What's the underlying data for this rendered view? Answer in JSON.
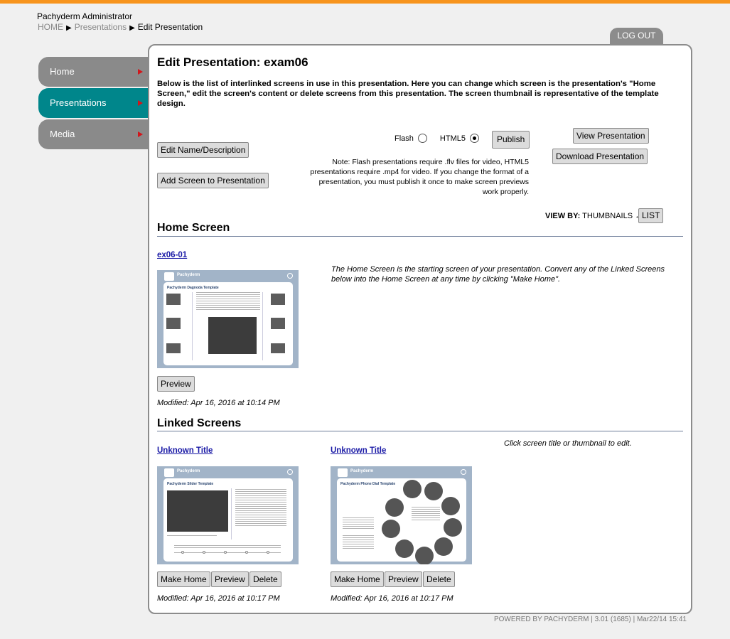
{
  "header": {
    "app_title": "Pachyderm Administrator",
    "breadcrumb": {
      "home": "HOME",
      "presentations": "Presentations",
      "current": "Edit Presentation"
    },
    "logout_label": "LOG OUT"
  },
  "sidebar": {
    "items": [
      {
        "label": "Home"
      },
      {
        "label": "Presentations"
      },
      {
        "label": "Media"
      }
    ]
  },
  "main": {
    "title": "Edit Presentation: exam06",
    "intro": "Below is the list of interlinked screens in use in this presentation. Here you can change which screen is the presentation's \"Home Screen,\" edit the screen's content or delete screens from this presentation. The screen thumbnail is representative of the template design.",
    "buttons": {
      "edit_name": "Edit Name/Description",
      "add_screen": "Add Screen to Presentation",
      "publish": "Publish",
      "view_presentation": "View Presentation",
      "download_presentation": "Download Presentation"
    },
    "format": {
      "flash_label": "Flash",
      "html5_label": "HTML5",
      "selected": "HTML5"
    },
    "note": "Note: Flash presentations require .flv files for video, HTML5 presentations require .mp4 for video. If you change the format of a presentation, you must publish it once to make screen previews work properly.",
    "view_by": {
      "label": "VIEW BY:",
      "current": "THUMBNAILS",
      "arrow": "↔",
      "alternative": "LIST"
    },
    "home_screen": {
      "section_title": "Home Screen",
      "screen_title": "ex06-01",
      "description": "The Home Screen is the starting screen of your presentation. Convert any of the Linked Screens below into the Home Screen at any time by clicking \"Make Home\".",
      "preview_label": "Preview",
      "modified": "Modified: Apr 16, 2016 at 10:14 PM",
      "thumbnail": {
        "brand": "Pachyderm",
        "template": "Pachyderm Dagnoda Template"
      }
    },
    "linked_screens": {
      "section_title": "Linked Screens",
      "hint": "Click screen title or thumbnail to edit.",
      "screens": [
        {
          "title": "Unknown Title",
          "make_home_label": "Make Home",
          "preview_label": "Preview",
          "delete_label": "Delete",
          "modified": "Modified: Apr 16, 2016 at 10:17 PM",
          "thumbnail": {
            "brand": "Pachyderm",
            "template": "Pachyderm Slider Template"
          }
        },
        {
          "title": "Unknown Title",
          "make_home_label": "Make Home",
          "preview_label": "Preview",
          "delete_label": "Delete",
          "modified": "Modified: Apr 16, 2016 at 10:17 PM",
          "thumbnail": {
            "brand": "Pachyderm",
            "template": "Pachyderm Phone Dial Template"
          }
        }
      ]
    }
  },
  "footer": "POWERED BY PACHYDERM | 3.01 (1685) | Mar22/14 15:41"
}
